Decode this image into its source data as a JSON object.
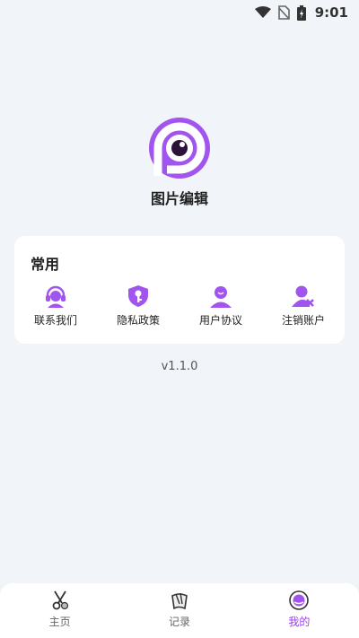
{
  "status_bar": {
    "time": "9:01"
  },
  "app": {
    "name": "图片编辑"
  },
  "card": {
    "title": "常用",
    "items": [
      {
        "label": "联系我们",
        "icon": "headset-icon"
      },
      {
        "label": "隐私政策",
        "icon": "shield-key-icon"
      },
      {
        "label": "用户协议",
        "icon": "user-icon"
      },
      {
        "label": "注销账户",
        "icon": "user-remove-icon"
      }
    ]
  },
  "version": "v1.1.0",
  "tabbar": {
    "items": [
      {
        "label": "主页",
        "icon": "scissors-icon",
        "active": false
      },
      {
        "label": "记录",
        "icon": "pages-icon",
        "active": false
      },
      {
        "label": "我的",
        "icon": "profile-circle-icon",
        "active": true
      }
    ]
  },
  "colors": {
    "accent": "#9b3ee8",
    "background": "#f1f4f8"
  }
}
